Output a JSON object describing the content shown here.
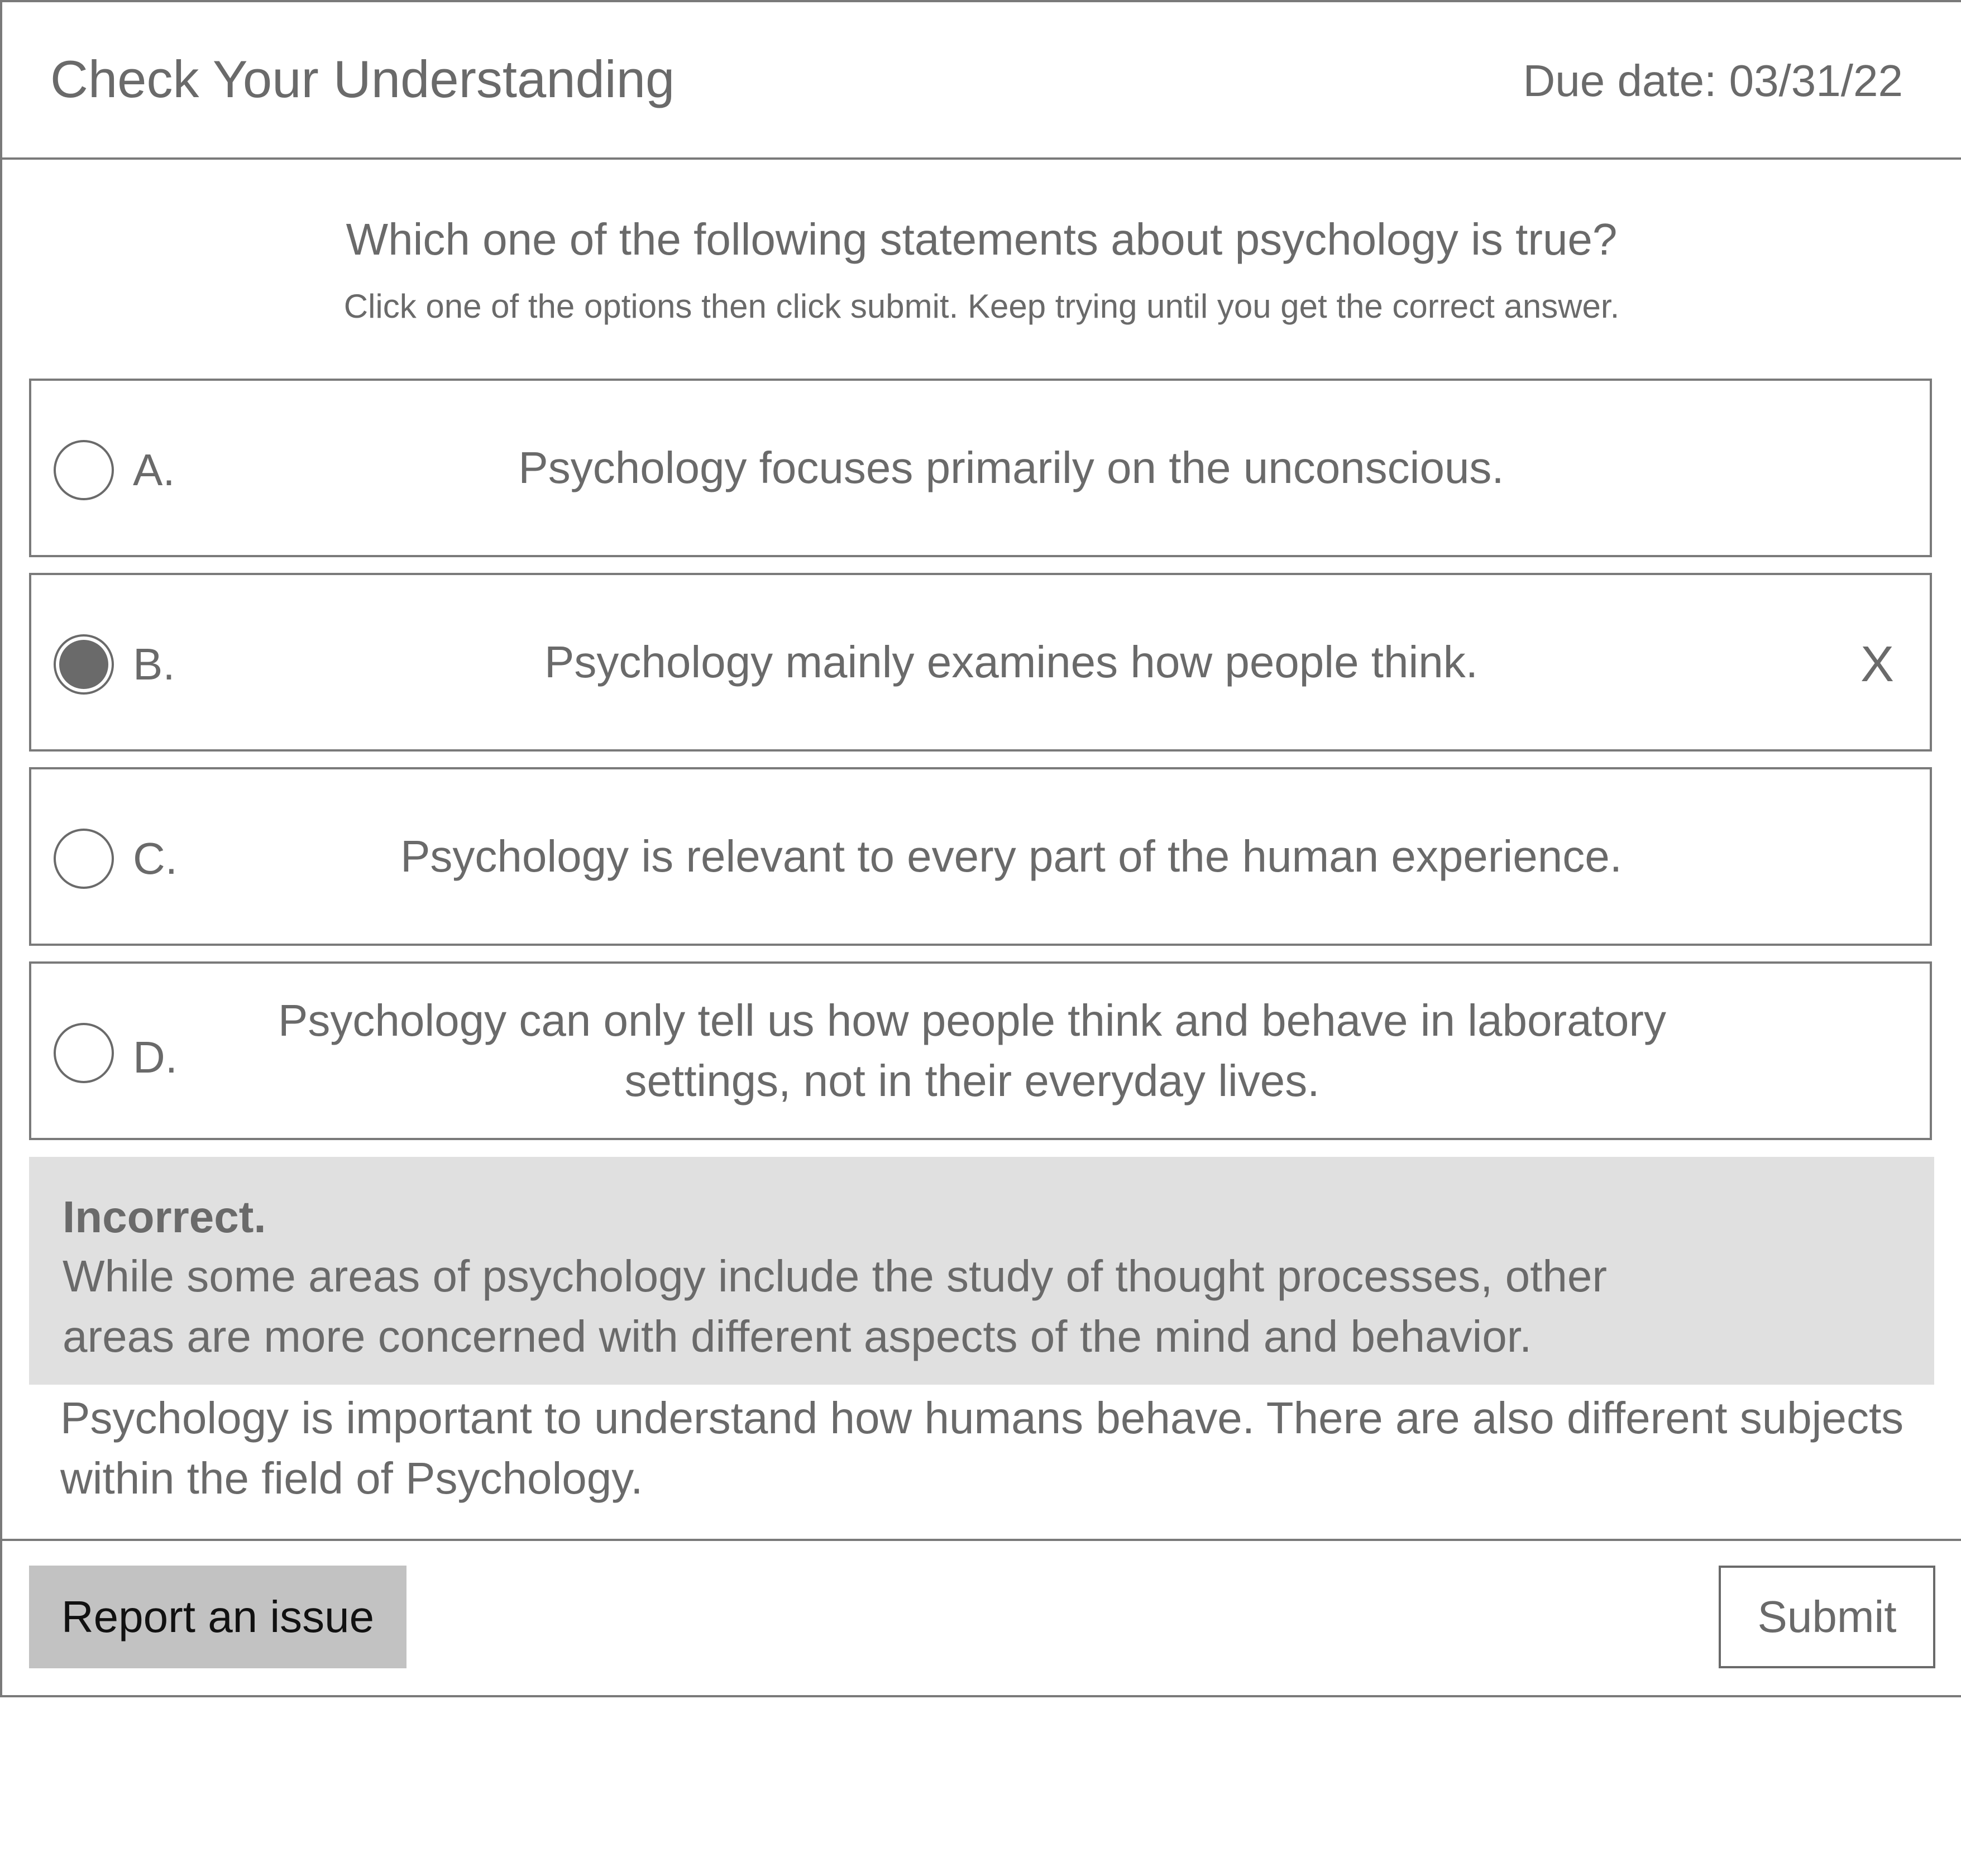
{
  "header": {
    "title": "Check Your Understanding",
    "due_date": "Due date: 03/31/22"
  },
  "question": {
    "prompt": "Which one of the following statements about psychology is true?",
    "instructions": "Click one of the options then click submit. Keep trying until you get the correct answer."
  },
  "options": [
    {
      "letter": "A.",
      "text": "Psychology focuses primarily on the unconscious.",
      "selected": false,
      "mark": ""
    },
    {
      "letter": "B.",
      "text": "Psychology mainly examines how people think.",
      "selected": true,
      "mark": "X"
    },
    {
      "letter": "C.",
      "text": "Psychology is relevant to every part of the human experience.",
      "selected": false,
      "mark": ""
    },
    {
      "letter": "D.",
      "text": "Psychology can only tell us how people think and behave in laboratory settings, not in their everyday lives.",
      "selected": false,
      "mark": ""
    }
  ],
  "feedback": {
    "status": "Incorrect.",
    "message": "While some areas of psychology include the study of thought processes, other areas are more concerned with different aspects of the mind and behavior."
  },
  "explanation": "Psychology is important to understand how humans behave. There are also different subjects within the field of Psychology.",
  "footer": {
    "report_label": "Report an issue",
    "submit_label": "Submit"
  },
  "colors": {
    "text": "#6a6a6a",
    "border": "#7a7a7a",
    "feedback_bg": "#e0e0e0",
    "report_bg": "#c2c2c2"
  }
}
